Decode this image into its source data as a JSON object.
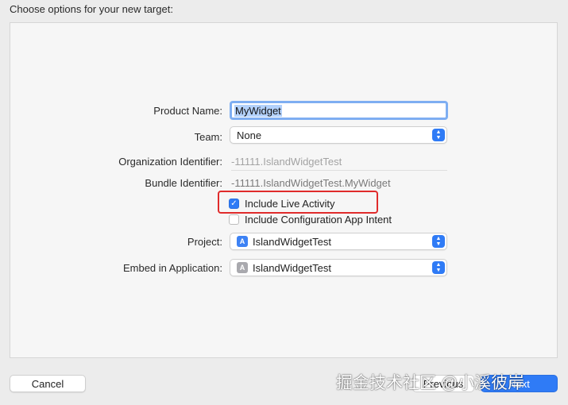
{
  "heading": "Choose options for your new target:",
  "form": {
    "product_name": {
      "label": "Product Name:",
      "value": "MyWidget"
    },
    "team": {
      "label": "Team:",
      "value": "None"
    },
    "org_identifier": {
      "label": "Organization Identifier:",
      "value": "-11111.IslandWidgetTest"
    },
    "bundle_identifier": {
      "label": "Bundle Identifier:",
      "value": "-11111.IslandWidgetTest.MyWidget"
    },
    "include_live_activity": {
      "label": "Include Live Activity",
      "checked": true
    },
    "include_config_intent": {
      "label": "Include Configuration App Intent",
      "checked": false
    },
    "project": {
      "label": "Project:",
      "value": "IslandWidgetTest",
      "icon": "app-blueprint-icon"
    },
    "embed": {
      "label": "Embed in Application:",
      "value": "IslandWidgetTest",
      "icon": "app-icon"
    }
  },
  "buttons": {
    "cancel": "Cancel",
    "previous": "Previous",
    "next": "Next"
  },
  "watermark": "掘金技术社区 @小溪彼岸",
  "colors": {
    "accent": "#2f7bf6",
    "highlight": "#e02b2b"
  }
}
